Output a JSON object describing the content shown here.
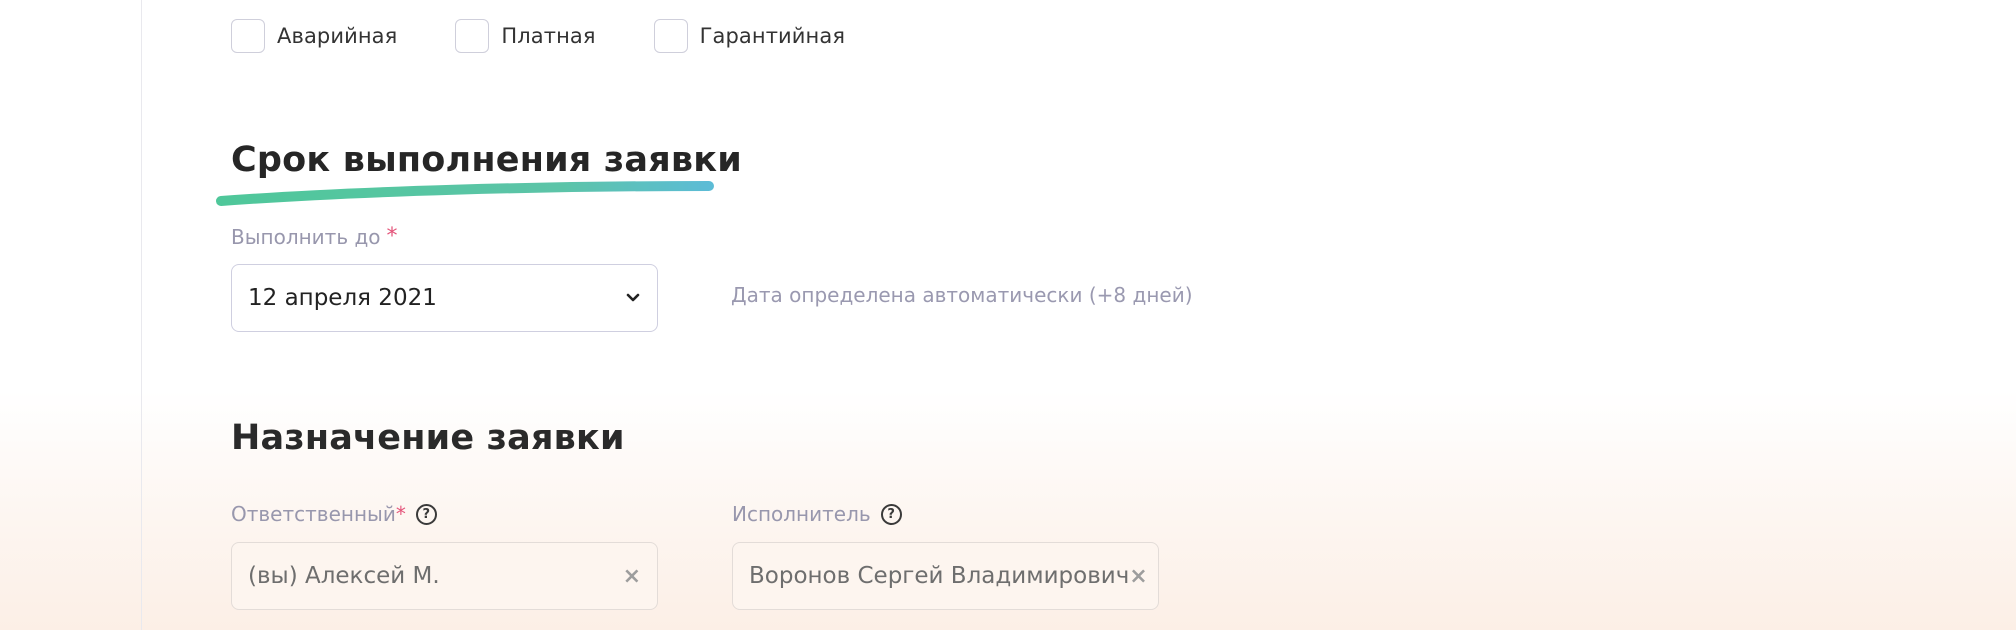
{
  "request_type": {
    "options": [
      {
        "label": "Аварийная",
        "checked": false
      },
      {
        "label": "Платная",
        "checked": false
      },
      {
        "label": "Гарантийная",
        "checked": false
      }
    ]
  },
  "deadline": {
    "heading": "Срок выполнения заявки",
    "field_label": "Выполнить до",
    "required_mark": "*",
    "value": "12 апреля 2021",
    "hint": "Дата определена автоматически (+8 дней)"
  },
  "assignment": {
    "heading": "Назначение заявки",
    "responsible": {
      "label": "Ответственный",
      "required_mark": "*",
      "help": "?",
      "value": "(вы) Алексей М.",
      "clear": "×"
    },
    "executor": {
      "label": "Исполнитель",
      "help": "?",
      "value": "Воронов Сергей Владимирович",
      "clear": "×"
    }
  },
  "colors": {
    "accent_green": "#4fc79a",
    "accent_blue": "#5cbcd6",
    "required": "#e4547a"
  }
}
